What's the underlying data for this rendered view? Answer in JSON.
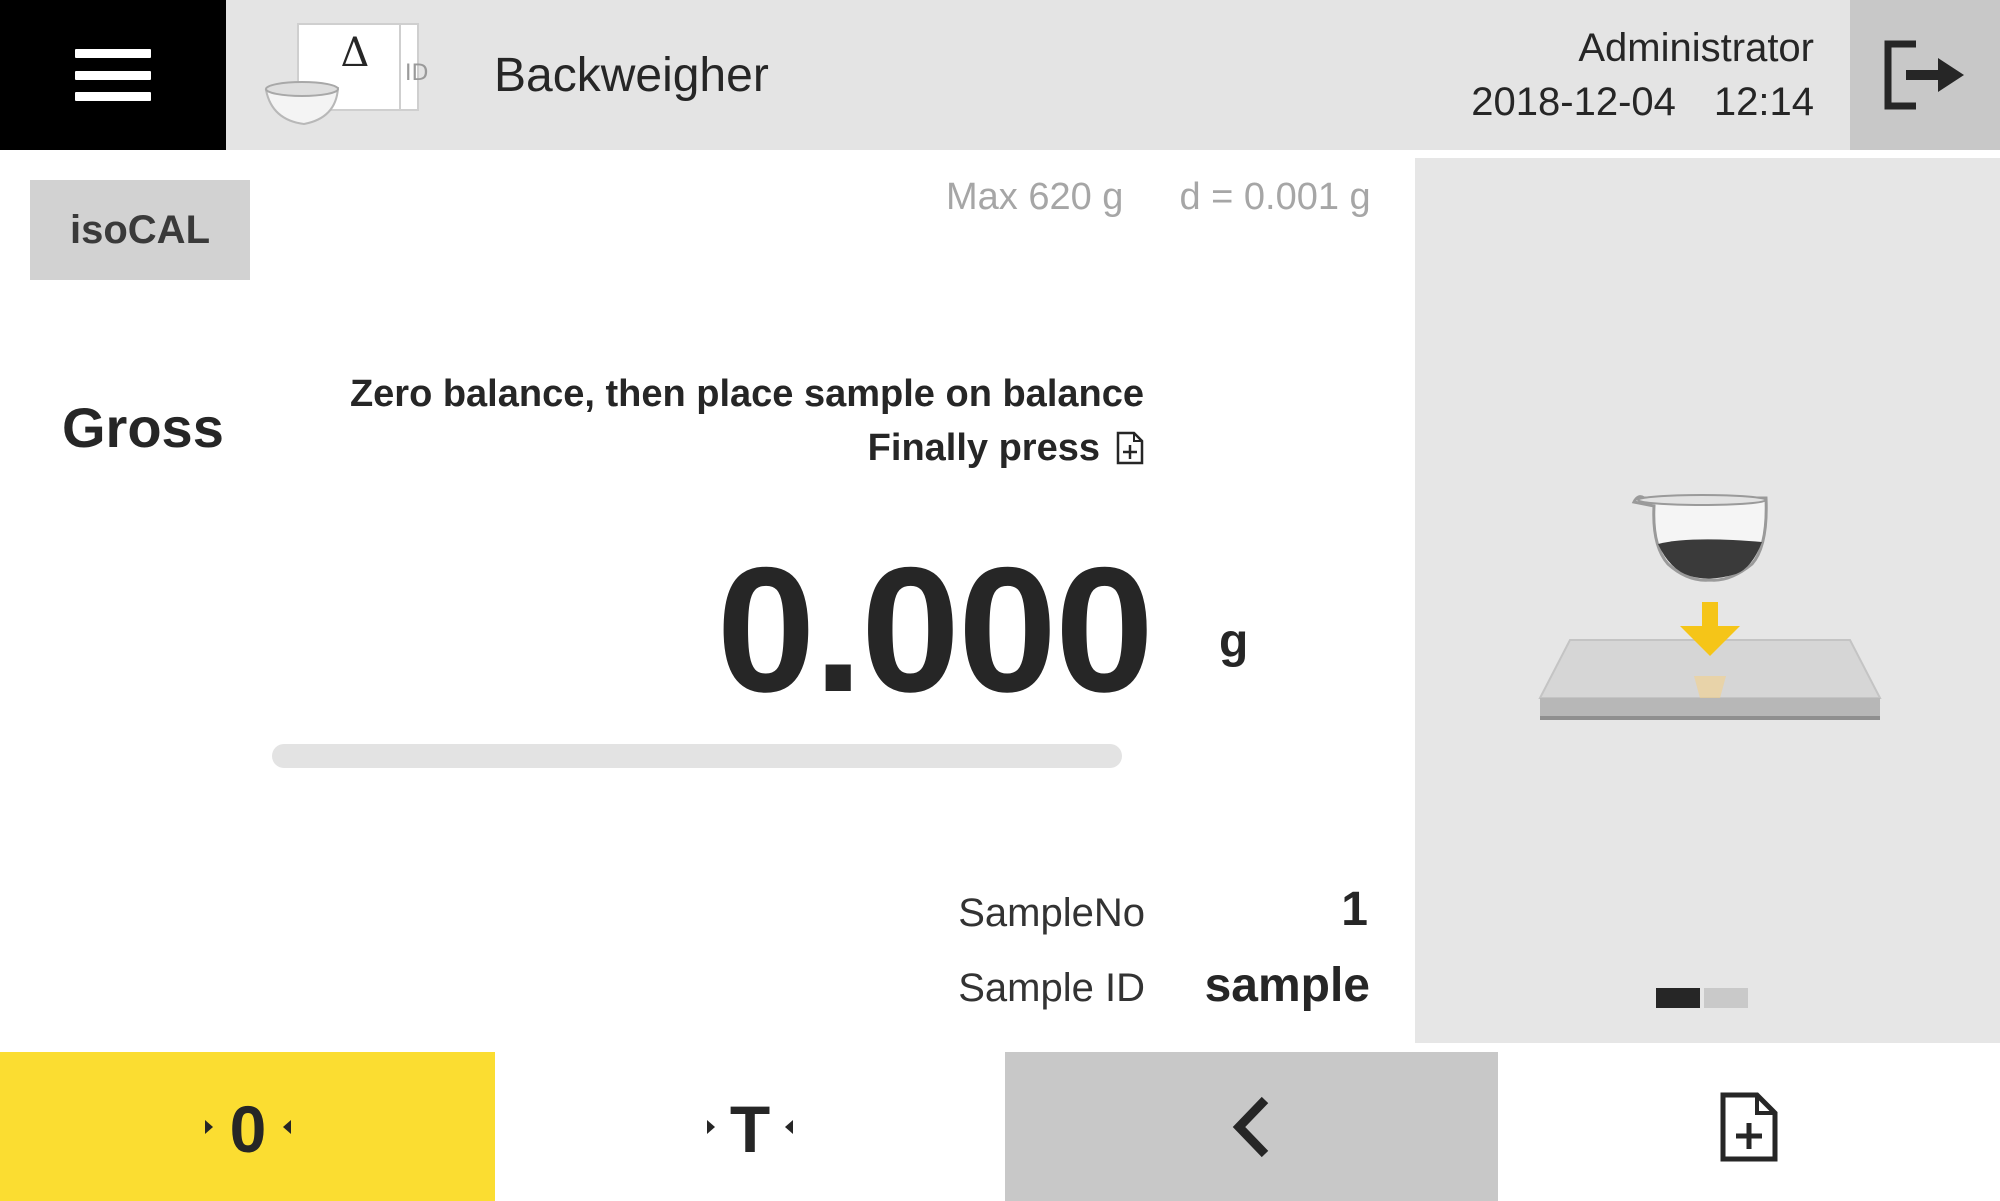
{
  "header": {
    "app_title": "Backweigher",
    "app_icon": {
      "delta": "Δ",
      "id_label": "ID"
    },
    "user": "Administrator",
    "date": "2018-12-04",
    "time": "12:14"
  },
  "main": {
    "isocal_label": "isoCAL",
    "max_capacity": "Max 620 g",
    "readability": "d = 0.001 g",
    "mode": "Gross",
    "instruction_line1": "Zero balance, then place sample on balance",
    "instruction_line2": "Finally press",
    "weight_value": "0.000",
    "weight_unit": "g",
    "stability_progress_percent": 0,
    "fields": [
      {
        "label": "SampleNo",
        "value": "1"
      },
      {
        "label": "Sample ID",
        "value": "sample"
      }
    ]
  },
  "illustration": {
    "pager_total": 2,
    "pager_active": 1,
    "arrow_color": "#f5c518"
  },
  "bottom_bar": {
    "zero_icon": "zero-icon",
    "tare_icon": "tare-icon",
    "back_icon": "chevron-left-icon",
    "add_icon": "add-document-icon"
  },
  "colors": {
    "accent_yellow": "#fbdd31",
    "header_bg": "#e4e4e4",
    "menu_bg": "#000000",
    "panel_gray": "#e6e6e6",
    "button_gray": "#c8c8c8"
  }
}
